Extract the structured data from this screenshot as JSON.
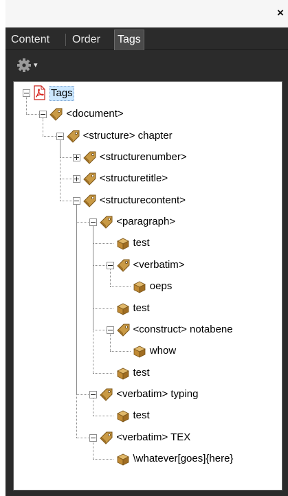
{
  "window": {
    "close_glyph": "×"
  },
  "tabs": [
    {
      "label": "Content",
      "active": false
    },
    {
      "label": "Order",
      "active": false
    },
    {
      "label": "Tags",
      "active": true
    }
  ],
  "options": {
    "icon": "gear-icon",
    "dropdown_glyph": "▾"
  },
  "tree": [
    {
      "label": "Tags",
      "icon": "pdf-icon",
      "expander": "minus",
      "selected": true
    },
    {
      "label": "<document>",
      "icon": "tag-icon",
      "expander": "minus"
    },
    {
      "label": "<structure> chapter",
      "icon": "tag-icon",
      "expander": "minus"
    },
    {
      "label": "<structurenumber>",
      "icon": "tag-icon",
      "expander": "plus"
    },
    {
      "label": "<structuretitle>",
      "icon": "tag-icon",
      "expander": "plus"
    },
    {
      "label": "<structurecontent>",
      "icon": "tag-icon",
      "expander": "minus"
    },
    {
      "label": "<paragraph>",
      "icon": "tag-icon",
      "expander": "minus"
    },
    {
      "label": "test",
      "icon": "box-icon"
    },
    {
      "label": "<verbatim>",
      "icon": "tag-icon",
      "expander": "minus"
    },
    {
      "label": "oeps",
      "icon": "box-icon"
    },
    {
      "label": "test",
      "icon": "box-icon"
    },
    {
      "label": "<construct> notabene",
      "icon": "tag-icon",
      "expander": "minus"
    },
    {
      "label": "whow",
      "icon": "box-icon"
    },
    {
      "label": "test",
      "icon": "box-icon"
    },
    {
      "label": "<verbatim> typing",
      "icon": "tag-icon",
      "expander": "minus"
    },
    {
      "label": "test",
      "icon": "box-icon"
    },
    {
      "label": "<verbatim> TEX",
      "icon": "tag-icon",
      "expander": "minus"
    },
    {
      "label": "\\whatever[goes]{here}",
      "icon": "box-icon"
    }
  ],
  "colors": {
    "panel": "#2b2b2b",
    "selection": "#cce8ff",
    "tag_gold": "#b58a3c",
    "pdf_red": "#d9221c"
  }
}
